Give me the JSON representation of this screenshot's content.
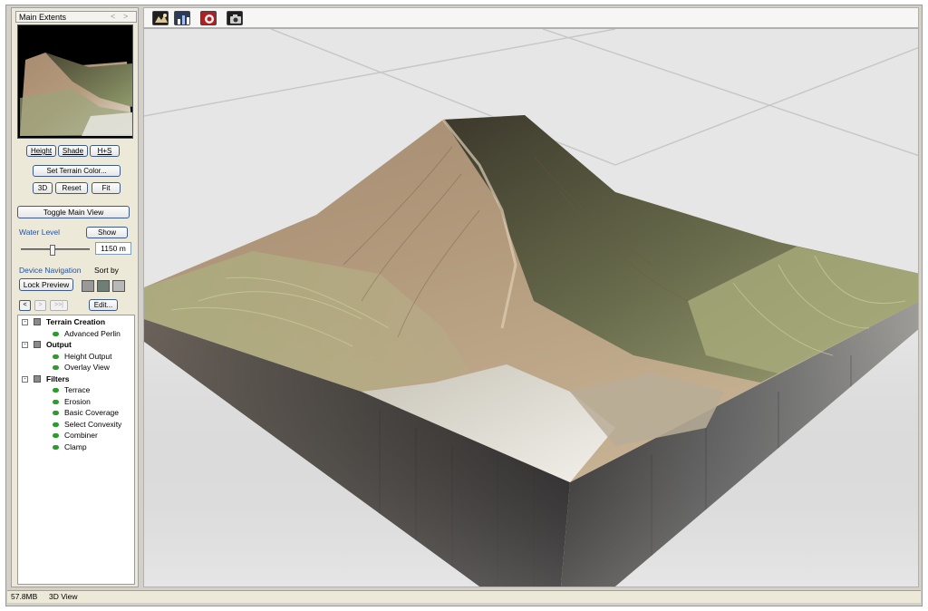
{
  "mini_panel": {
    "title": "Main Extents",
    "prev_glyph": "<",
    "next_glyph": ">"
  },
  "view_buttons": {
    "height": "Height",
    "shade": "Shade",
    "hs": "H+S"
  },
  "set_terrain_color": "Set Terrain Color...",
  "action_buttons": {
    "three_d": "3D",
    "reset": "Reset",
    "fit": "Fit"
  },
  "toggle_main_view": "Toggle Main View",
  "water": {
    "label": "Water Level",
    "show": "Show",
    "value": "1150 m",
    "slider_fraction": 0.45
  },
  "device_nav": {
    "label": "Device Navigation",
    "sort_by": "Sort by",
    "lock_preview": "Lock Preview",
    "edit": "Edit...",
    "back_glyph": "<",
    "forward_glyph": ">",
    "end_glyph": ">>|"
  },
  "tree": [
    {
      "group": "Terrain Creation",
      "expand": "-",
      "children": [
        "Advanced Perlin"
      ]
    },
    {
      "group": "Output",
      "expand": "-",
      "children": [
        "Height Output",
        "Overlay View"
      ]
    },
    {
      "group": "Filters",
      "expand": "-",
      "children": [
        "Terrace",
        "Erosion",
        "Basic Coverage",
        "Select Convexity",
        "Combiner",
        "Clamp"
      ]
    }
  ],
  "toolbar_icons": [
    "erosion-tool-icon",
    "graph-tool-icon",
    "render-tool-icon",
    "camera-icon"
  ],
  "status": {
    "memory": "57.8MB",
    "mode": "3D View"
  },
  "colors": {
    "accent_blue": "#2552a3",
    "tree_dot_green": "#2f9a2f",
    "viewport_bg": "#e6e6e6"
  }
}
